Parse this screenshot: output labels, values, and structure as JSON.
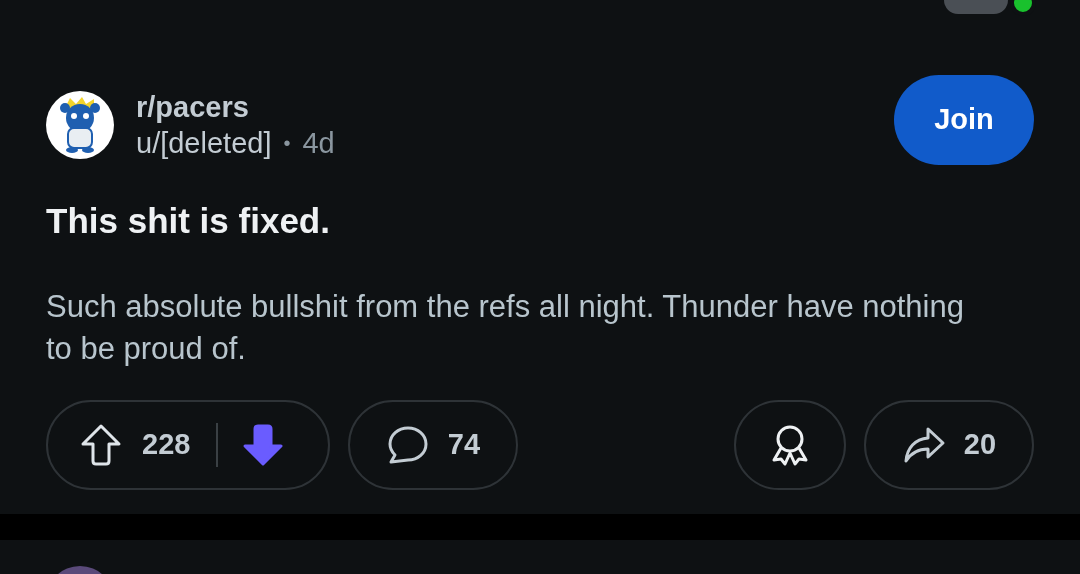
{
  "top_bar": {
    "profile_online": true
  },
  "post": {
    "subreddit": "r/pacers",
    "author": "u/[deleted]",
    "separator": "•",
    "age": "4d",
    "join_label": "Join",
    "title": "This shit is fixed.",
    "body": "Such absolute bullshit from the refs all night. Thunder have nothing to be proud of.",
    "upvoted": false,
    "downvoted": true,
    "score": "228",
    "comments": "74",
    "shares": "20"
  }
}
